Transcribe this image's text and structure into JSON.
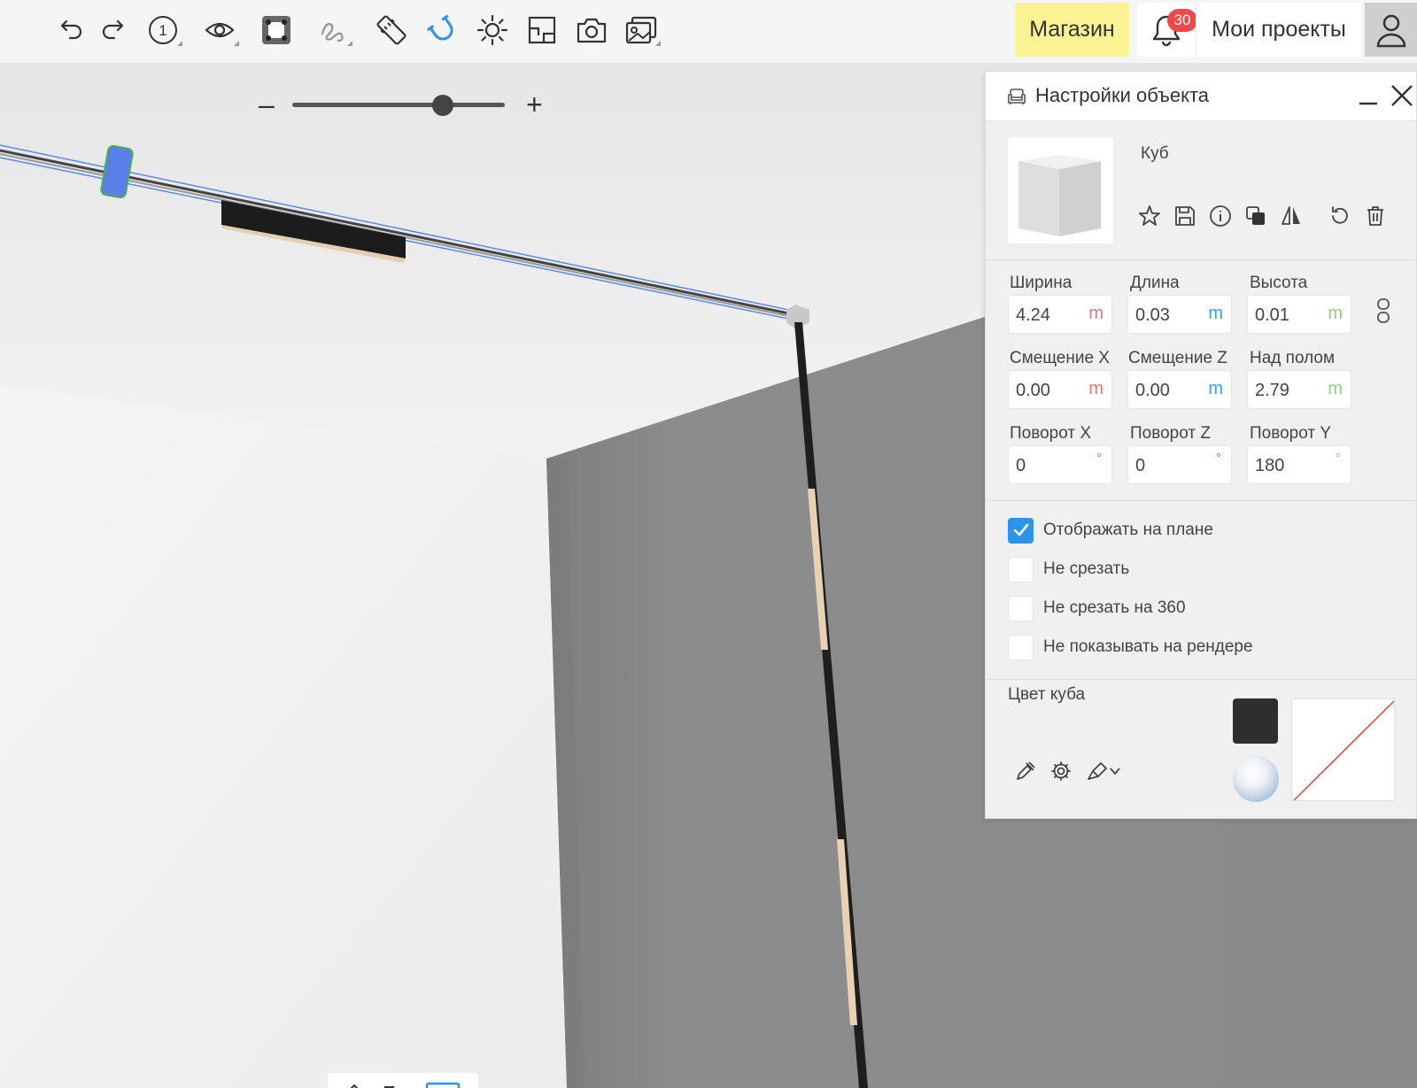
{
  "toolbar": {
    "tools": [
      {
        "icon": "undo-icon",
        "name": "undo-button"
      },
      {
        "icon": "redo-icon",
        "name": "redo-button"
      },
      {
        "icon": "floor-number-icon",
        "name": "floor-button",
        "text": "1"
      },
      {
        "icon": "eye-icon",
        "name": "visibility-button"
      },
      {
        "icon": "select-frame-icon",
        "name": "select-frame-button"
      },
      {
        "icon": "freehand-icon",
        "name": "freehand-button"
      },
      {
        "icon": "ruler-icon",
        "name": "ruler-button"
      },
      {
        "icon": "magnet-icon",
        "name": "magnet-button",
        "active": true
      },
      {
        "icon": "sun-icon",
        "name": "lighting-button"
      },
      {
        "icon": "floor-plan-icon",
        "name": "floor-plan-button"
      },
      {
        "icon": "camera-icon",
        "name": "camera-button"
      },
      {
        "icon": "gallery-icon",
        "name": "gallery-button"
      }
    ],
    "shop_label": "Магазин",
    "notifications_count": "30",
    "projects_label": "Мои проекты"
  },
  "zoom": {
    "minus": "–",
    "plus": "+",
    "level": 0.71
  },
  "panel": {
    "title": "Настройки объекта",
    "object_name": "Куб",
    "dimensions": {
      "width_label": "Ширина",
      "width_value": "4.24",
      "width_unit": "m",
      "length_label": "Длина",
      "length_value": "0.03",
      "length_unit": "m",
      "height_label": "Высота",
      "height_value": "0.01",
      "height_unit": "m"
    },
    "offsets": {
      "x_label": "Смещение X",
      "x_value": "0.00",
      "x_unit": "m",
      "z_label": "Смещение Z",
      "z_value": "0.00",
      "z_unit": "m",
      "floor_label": "Над полом",
      "floor_value": "2.79",
      "floor_unit": "m"
    },
    "rotation": {
      "x_label": "Поворот X",
      "x_value": "0",
      "x_unit": "°",
      "z_label": "Поворот Z",
      "z_value": "0",
      "z_unit": "°",
      "y_label": "Поворот Y",
      "y_value": "180",
      "y_unit": "°"
    },
    "checkboxes": [
      {
        "label": "Отображать на плане",
        "checked": true
      },
      {
        "label": "Не срезать",
        "checked": false
      },
      {
        "label": "Не срезать на 360",
        "checked": false
      },
      {
        "label": "Не показывать на рендере",
        "checked": false
      }
    ],
    "color_label": "Цвет куба",
    "color_value": "#2e2e2e"
  },
  "colors": {
    "accent": "#2f93ec",
    "shop_bg": "#fbf291",
    "badge": "#f04848"
  }
}
